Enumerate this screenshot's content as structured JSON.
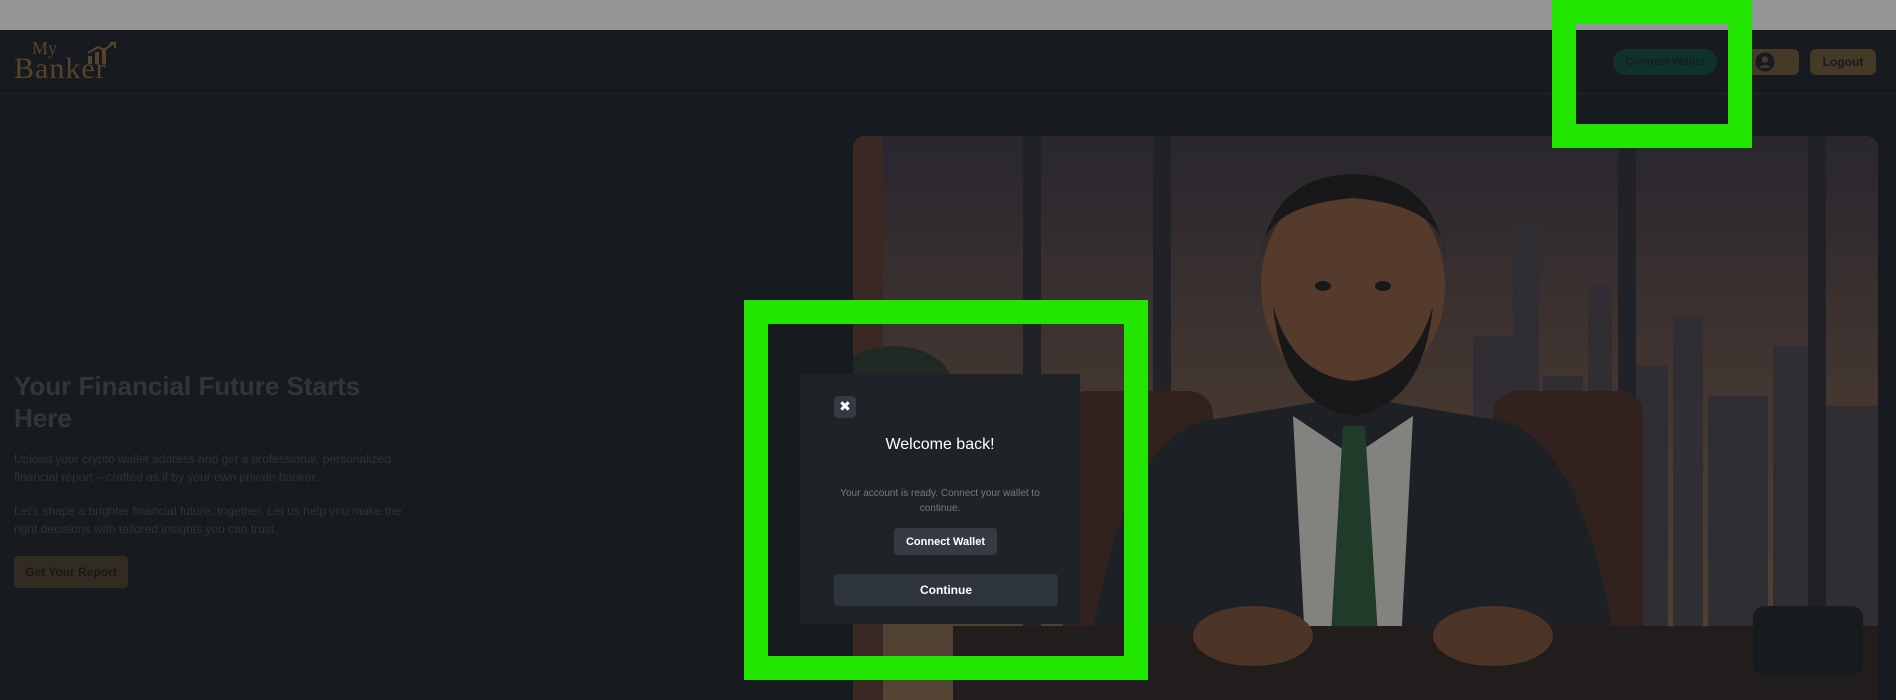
{
  "header": {
    "logo_line1": "My",
    "logo_line2": "Banker",
    "connect_wallet_label": "Connect Wallet",
    "logout_label": "Logout",
    "profile_icon": "user-circle-icon"
  },
  "hero": {
    "title": "Your Financial Future Starts Here",
    "paragraph1": "Upload your crypto wallet address and get a professional, personalized financial report – crafted as if by your own private banker.",
    "paragraph2": "Let’s shape a brighter financial future, together. Let us help you make the right decisions with tailored insights you can trust.",
    "cta_label": "Get Your Report"
  },
  "modal": {
    "close_symbol": "✖",
    "title": "Welcome back!",
    "message": "Your account is ready. Connect your wallet to continue.",
    "connect_label": "Connect Wallet",
    "continue_label": "Continue"
  },
  "colors": {
    "background": "#1b1f24",
    "accent_gold": "#8a6a36",
    "wallet_green": "#0f4a3b",
    "highlight": "#22e600"
  }
}
